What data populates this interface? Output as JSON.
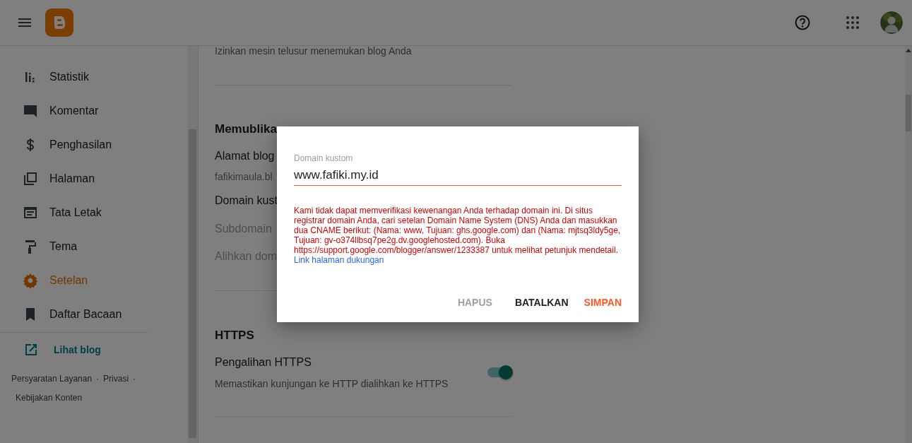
{
  "sidebar": {
    "items": [
      {
        "label": "Statistik",
        "kind": "stats",
        "selected": false
      },
      {
        "label": "Komentar",
        "kind": "comment",
        "selected": false
      },
      {
        "label": "Penghasilan",
        "kind": "dollar",
        "selected": false
      },
      {
        "label": "Halaman",
        "kind": "pages",
        "selected": false
      },
      {
        "label": "Tata Letak",
        "kind": "layout",
        "selected": false
      },
      {
        "label": "Tema",
        "kind": "theme",
        "selected": false
      },
      {
        "label": "Setelan",
        "kind": "settings",
        "selected": true
      },
      {
        "label": "Daftar Bacaan",
        "kind": "bookmark",
        "selected": false
      }
    ],
    "view_blog": "Lihat blog",
    "footer": {
      "links": [
        "Persyaratan Layanan",
        "Privasi",
        "Kebijakan Konten"
      ],
      "separator": "·"
    }
  },
  "settings": {
    "search_description": "Izinkan mesin telusur menemukan blog Anda",
    "publishing": {
      "title": "Memublika",
      "rows": [
        {
          "text": "Alamat blog",
          "kind": "title"
        },
        {
          "text": "fafikimaula.bl",
          "kind": "value"
        },
        {
          "text": "Domain kust",
          "kind": "title"
        },
        {
          "text": "Subdomain",
          "kind": "muted"
        },
        {
          "text": "Alihkan dom",
          "kind": "muted"
        }
      ]
    },
    "https": {
      "title": "HTTPS",
      "setting": {
        "title": "Pengalihan HTTPS",
        "description": "Memastikan kunjungan ke HTTP dialihkan ke HTTPS",
        "on": true
      }
    }
  },
  "dialog": {
    "field": {
      "label": "Domain kustom",
      "value": "www.fafiki.my.id",
      "error": true
    },
    "error_message": "Kami tidak dapat memverifikasi kewenangan Anda terhadap domain ini. Di situs registrar domain Anda, cari setelan Domain Name System (DNS) Anda dan masukkan dua CNAME berikut: (Nama: www, Tujuan: ghs.google.com) dan (Nama: mjtsq3ldy5ge, Tujuan: gv-o374llbsq7pe2g.dv.googlehosted.com). Buka https://support.google.com/blogger/answer/1233387 untuk melihat petunjuk mendetail.",
    "link": "Link halaman dukungan",
    "buttons": [
      {
        "label": "HAPUS",
        "kind": "disabled"
      },
      {
        "label": "BATALKAN",
        "kind": "default"
      },
      {
        "label": "SIMPAN",
        "kind": "primary"
      }
    ]
  }
}
